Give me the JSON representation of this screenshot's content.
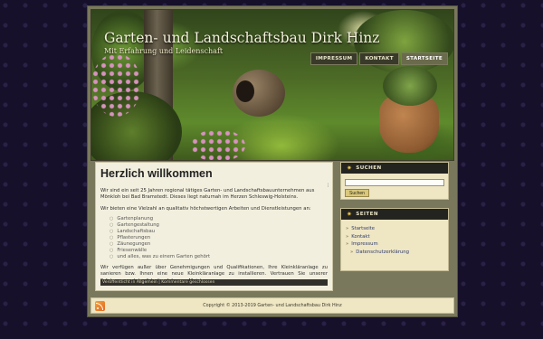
{
  "site": {
    "title": "Garten- und Landschaftsbau Dirk Hinz",
    "description": "Mit Erfahrung und Leidenschaft"
  },
  "nav": {
    "items": [
      {
        "label": "IMPRESSUM"
      },
      {
        "label": "KONTAKT"
      },
      {
        "label": "STARTSEITE"
      }
    ],
    "active_index": 2
  },
  "post": {
    "title": "Herzlich willkommen",
    "edit_mark": "¦",
    "intro": "Wir sind ein seit 25 Jahren regional tätiges Garten- und Landschaftsbauunternehmen aus Mönkloh bei Bad Bramstedt. Dieses liegt naturnah im Herzen Schleswig-Holsteins.",
    "services_intro": "Wir bieten eine Vielzahl an qualitativ höchstwertigen Arbeiten und Dienstleistungen an:",
    "services": [
      "Gartenplanung",
      "Gartengestaltung",
      "Landschaftsbau",
      "Pflasterungen",
      "Zäunegungen",
      "Friesenwälle",
      "und alles, was zu einem Garten gehört"
    ],
    "outro": "Wir verfügen außer über Genehmigungen und Qualifikationen, Ihre Kleinkläranlage zu sanieren bzw. Ihnen eine neue Kleinkläranlage zu installieren. Vertrauen Sie unserer Erfahrung und der Arbeit erfahrener Meister.",
    "meta": {
      "prefix": "Veröffentlicht in",
      "category": "Allgemein",
      "separator": "|",
      "comments": "Kommentare geschlossen"
    }
  },
  "sidebar": {
    "search": {
      "heading": "SUCHEN",
      "placeholder": "",
      "button_label": "Suchen"
    },
    "pages": {
      "heading": "SEITEN",
      "items": [
        {
          "label": "Startseite",
          "sub": false
        },
        {
          "label": "Kontakt",
          "sub": false
        },
        {
          "label": "Impressum",
          "sub": false
        },
        {
          "label": "Datenschutzerklärung",
          "sub": true
        }
      ]
    }
  },
  "footer": {
    "copyright": "Copyright © 2013-2019 Garten- und Landschaftsbau Dirk Hinz"
  },
  "icons": {
    "widget_bullet": "star-icon",
    "feed": "rss-icon"
  },
  "colors": {
    "accent": "#f0c843",
    "link": "#2c3a6b",
    "rss": "#e0691c"
  }
}
